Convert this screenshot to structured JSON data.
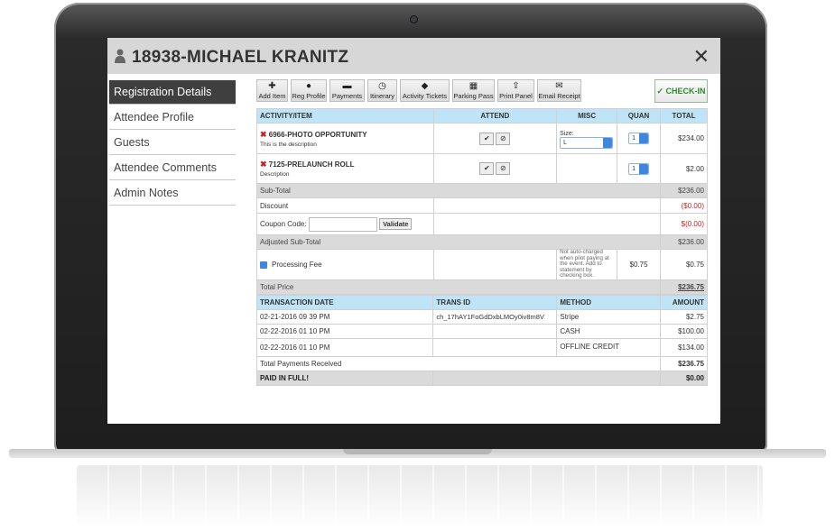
{
  "header": {
    "title": "18938-MICHAEL KRANITZ",
    "close": "✕"
  },
  "sidebar": {
    "items": [
      {
        "label": "Registration Details",
        "active": true
      },
      {
        "label": "Attendee Profile"
      },
      {
        "label": "Guests"
      },
      {
        "label": "Attendee Comments"
      },
      {
        "label": "Admin Notes"
      }
    ]
  },
  "toolbar": {
    "add_item": "Add Item",
    "reg_profile": "Reg Profile",
    "payments": "Payments",
    "itinerary": "Itinerary",
    "activity_tickets": "Activity Tickets",
    "parking_pass": "Parking Pass",
    "print_panel": "Print Panel",
    "email_receipt": "Email Receipt",
    "checkin": "✓ CHECK-IN"
  },
  "items_table": {
    "headers": {
      "activity": "ACTIVITY/ITEM",
      "attend": "ATTEND",
      "misc": "MISC",
      "quan": "QUAN",
      "total": "TOTAL"
    },
    "rows": [
      {
        "name": "6966-PHOTO OPPORTUNITY",
        "desc": "This is the description",
        "misc_label": "Size:",
        "misc_value": "L",
        "qty": "1",
        "total": "$234.00"
      },
      {
        "name": "7125-PRELAUNCH ROLL",
        "desc": "Description",
        "qty": "1",
        "total": "$2.00"
      }
    ],
    "subtotal_label": "Sub-Total",
    "subtotal": "$236.00",
    "discount_label": "Discount",
    "discount": "($0.00)",
    "coupon_label": "Coupon Code:",
    "validate": "Validate",
    "coupon_amount": "$(0.00)",
    "adjusted_label": "Adjusted Sub-Total",
    "adjusted": "$236.00",
    "fee_label": "Processing Fee",
    "fee_note": "Not auto-charged when pilot paying at the event. Add to statement by checking box.",
    "fee_amount": "$0.75",
    "fee_total": "$0.75",
    "total_label": "Total Price",
    "total": "$236.75"
  },
  "transactions": {
    "headers": {
      "date": "TRANSACTION DATE",
      "id": "TRANS ID",
      "method": "METHOD",
      "amount": "AMOUNT"
    },
    "rows": [
      {
        "date": "02-21-2016 09 39 PM",
        "id": "ch_17hAY1FoGdDxbLMOy0iv8m8V",
        "method": "Stripe",
        "amount": "$2.75"
      },
      {
        "date": "02-22-2016 01 10 PM",
        "id": "",
        "method": "CASH",
        "amount": "$100.00"
      },
      {
        "date": "02-22-2016 01 10 PM",
        "id": "",
        "method": "OFFLINE CREDIT",
        "amount": "$134.00"
      }
    ],
    "received_label": "Total Payments Received",
    "received": "$236.75",
    "paid_label": "PAID IN FULL!",
    "paid": "$0.00"
  }
}
